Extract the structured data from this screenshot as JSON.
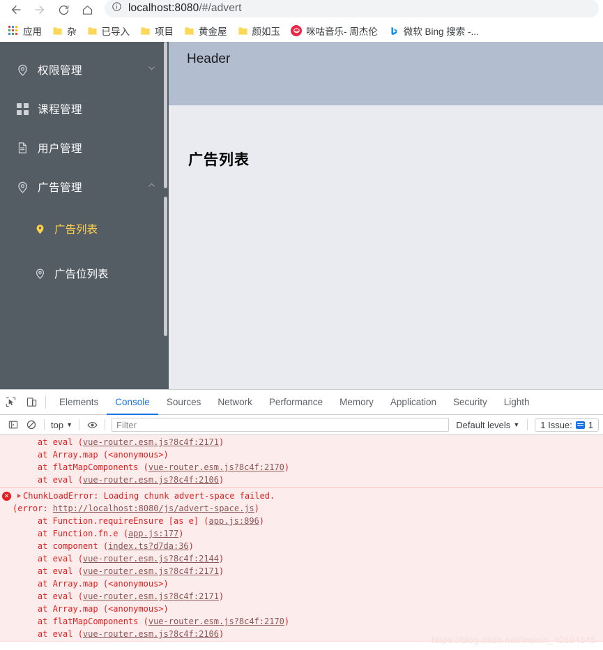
{
  "browser": {
    "nav": {
      "back_label": "Back",
      "forward_label": "Forward",
      "reload_label": "Reload",
      "home_label": "Home"
    },
    "omnibox": {
      "url_prefix": "localhost:8080",
      "url_suffix": "/#/advert",
      "full_url": "localhost:8080/#/advert",
      "info_icon": "info-circle-icon"
    },
    "bookmarks": [
      {
        "label": "应用",
        "icon": "apps-grid-icon"
      },
      {
        "label": "杂",
        "icon": "folder-icon"
      },
      {
        "label": "已导入",
        "icon": "folder-icon"
      },
      {
        "label": "项目",
        "icon": "folder-icon"
      },
      {
        "label": "黄金屋",
        "icon": "folder-icon"
      },
      {
        "label": "颜如玉",
        "icon": "folder-icon"
      },
      {
        "label": "咪咕音乐- 周杰伦",
        "icon": "migu-favicon",
        "color": "#e8294a"
      },
      {
        "label": "微软 Bing 搜索 -...",
        "icon": "bing-favicon",
        "color": "#1a8fe3"
      }
    ]
  },
  "page": {
    "sidebar": {
      "bg_color": "#545c64",
      "active_color": "#ffd04b",
      "items": [
        {
          "label": "权限管理",
          "icon": "location-pin-icon",
          "arrow": "chevron-down-icon",
          "expanded": false
        },
        {
          "label": "课程管理",
          "icon": "grid-squares-icon",
          "arrow": "",
          "expanded": false
        },
        {
          "label": "用户管理",
          "icon": "document-icon",
          "arrow": "",
          "expanded": false
        },
        {
          "label": "广告管理",
          "icon": "location-pin-icon",
          "arrow": "chevron-up-icon",
          "expanded": true
        }
      ],
      "subitems": [
        {
          "label": "广告列表",
          "icon": "location-pin-icon",
          "active": true
        },
        {
          "label": "广告位列表",
          "icon": "location-pin-icon",
          "active": false
        }
      ]
    },
    "header": {
      "title": "Header",
      "bg_color": "#b3bdd0"
    },
    "content": {
      "title": "广告列表",
      "bg_color": "#e9ebf0"
    }
  },
  "devtools": {
    "toolbar_icons": [
      {
        "name": "inspect-element-icon"
      },
      {
        "name": "device-toolbar-icon"
      }
    ],
    "tabs": [
      {
        "label": "Elements",
        "active": false
      },
      {
        "label": "Console",
        "active": true
      },
      {
        "label": "Sources",
        "active": false
      },
      {
        "label": "Network",
        "active": false
      },
      {
        "label": "Performance",
        "active": false
      },
      {
        "label": "Memory",
        "active": false
      },
      {
        "label": "Application",
        "active": false
      },
      {
        "label": "Security",
        "active": false
      },
      {
        "label": "Lighth",
        "active": false
      }
    ],
    "filterbar": {
      "sidebar_toggle_icon": "console-sidebar-icon",
      "clear_icon": "clear-console-icon",
      "context_label": "top",
      "context_caret": "▼",
      "eye_icon": "live-expression-icon",
      "filter_placeholder": "Filter",
      "filter_value": "",
      "levels_label": "Default levels",
      "levels_caret": "▼",
      "issues_label": "1 Issue:",
      "issues_count": "1"
    },
    "console_groups": [
      {
        "has_error_icon": false,
        "lines": [
          {
            "text": "    at eval (",
            "link": "vue-router.esm.js?8c4f:2171",
            "tail": ")"
          },
          {
            "text": "    at Array.map (<anonymous>)",
            "link": "",
            "tail": ""
          },
          {
            "text": "    at flatMapComponents (",
            "link": "vue-router.esm.js?8c4f:2170",
            "tail": ")"
          },
          {
            "text": "    at eval (",
            "link": "vue-router.esm.js?8c4f:2106",
            "tail": ")"
          }
        ]
      },
      {
        "has_error_icon": true,
        "lines": [
          {
            "text": "ChunkLoadError: Loading chunk advert-space failed.",
            "link": "",
            "tail": "",
            "head": true
          },
          {
            "text": "(error: ",
            "link": "http://localhost:8080/js/advert-space.js",
            "tail": ")"
          },
          {
            "text": "    at Function.requireEnsure [as e] (",
            "link": "app.js:896",
            "tail": ")"
          },
          {
            "text": "    at Function.fn.e (",
            "link": "app.js:177",
            "tail": ")"
          },
          {
            "text": "    at component (",
            "link": "index.ts?d7da:36",
            "tail": ")"
          },
          {
            "text": "    at eval (",
            "link": "vue-router.esm.js?8c4f:2144",
            "tail": ")"
          },
          {
            "text": "    at eval (",
            "link": "vue-router.esm.js?8c4f:2171",
            "tail": ")"
          },
          {
            "text": "    at Array.map (<anonymous>)",
            "link": "",
            "tail": ""
          },
          {
            "text": "    at eval (",
            "link": "vue-router.esm.js?8c4f:2171",
            "tail": ")"
          },
          {
            "text": "    at Array.map (<anonymous>)",
            "link": "",
            "tail": ""
          },
          {
            "text": "    at flatMapComponents (",
            "link": "vue-router.esm.js?8c4f:2170",
            "tail": ")"
          },
          {
            "text": "    at eval (",
            "link": "vue-router.esm.js?8c4f:2106",
            "tail": ")"
          }
        ]
      }
    ],
    "watermark": "https://blog.csdn.net/weixin_40594645"
  }
}
